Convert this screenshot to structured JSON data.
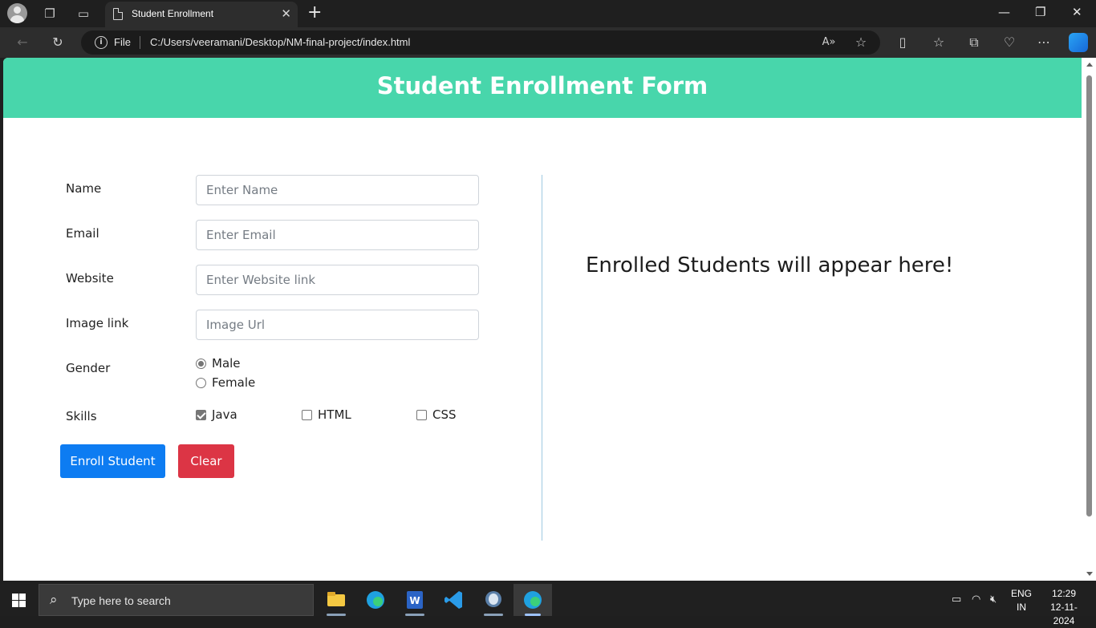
{
  "browser": {
    "tab_title": "Student Enrollment",
    "address_scheme": "File",
    "address_url": "C:/Users/veeramani/Desktop/NM-final-project/index.html"
  },
  "page": {
    "header_title": "Student Enrollment Form",
    "form": {
      "name_label": "Name",
      "name_placeholder": "Enter Name",
      "email_label": "Email",
      "email_placeholder": "Enter Email",
      "website_label": "Website",
      "website_placeholder": "Enter Website link",
      "image_label": "Image link",
      "image_placeholder": "Image Url",
      "gender_label": "Gender",
      "gender_options": [
        {
          "label": "Male",
          "selected": true
        },
        {
          "label": "Female",
          "selected": false
        }
      ],
      "skills_label": "Skills",
      "skills": [
        {
          "label": "Java",
          "checked": true
        },
        {
          "label": "HTML",
          "checked": false
        },
        {
          "label": "CSS",
          "checked": false
        }
      ],
      "enroll_button": "Enroll Student",
      "clear_button": "Clear"
    },
    "empty_message": "Enrolled Students will appear here!",
    "colors": {
      "header": "#48d6ab",
      "enroll": "#0d7cf2",
      "clear": "#dc3545"
    }
  },
  "taskbar": {
    "search_placeholder": "Type here to search",
    "language_line1": "ENG",
    "language_line2": "IN",
    "time": "12:29",
    "date": "12-11-2024",
    "apps": [
      "file-explorer",
      "edge",
      "word",
      "vscode",
      "postgresql",
      "edge-active"
    ]
  }
}
